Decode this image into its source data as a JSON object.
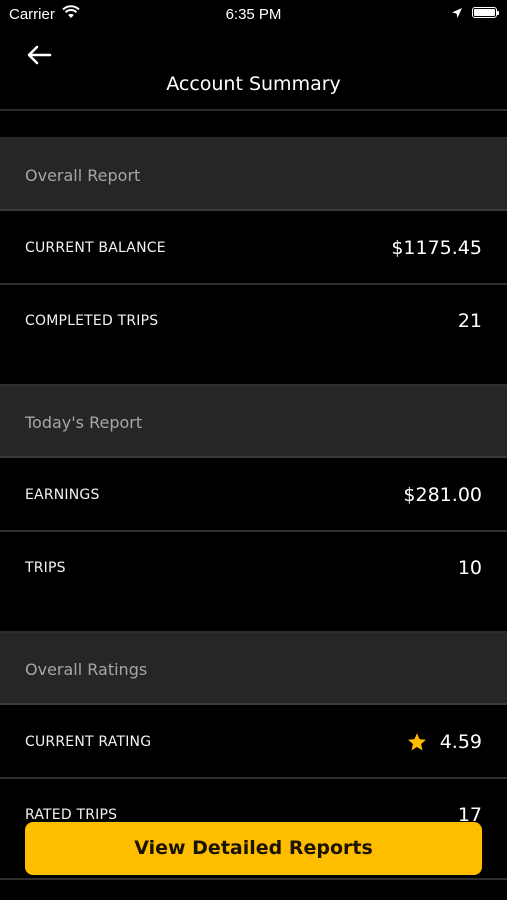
{
  "status_bar": {
    "carrier": "Carrier",
    "time": "6:35 PM"
  },
  "header": {
    "title": "Account Summary"
  },
  "sections": [
    {
      "title": "Overall Report",
      "rows": [
        {
          "label": "CURRENT BALANCE",
          "value": "$1175.45"
        },
        {
          "label": "COMPLETED TRIPS",
          "value": "21"
        }
      ]
    },
    {
      "title": "Today's Report",
      "rows": [
        {
          "label": "EARNINGS",
          "value": "$281.00"
        },
        {
          "label": "TRIPS",
          "value": "10"
        }
      ]
    },
    {
      "title": "Overall Ratings",
      "rows": [
        {
          "label": "CURRENT RATING",
          "value": "4.59",
          "icon": "star-icon"
        },
        {
          "label": "RATED TRIPS",
          "value": "17"
        }
      ]
    }
  ],
  "footer": {
    "button_label": "View Detailed Reports"
  },
  "colors": {
    "accent": "#ffbd00",
    "section_bg": "#262626",
    "background": "#000000"
  }
}
